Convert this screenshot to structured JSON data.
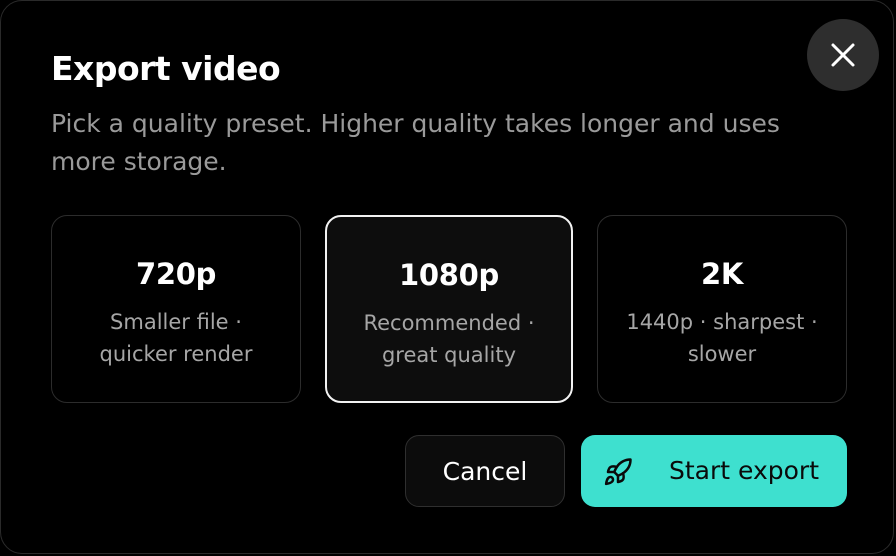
{
  "dialog": {
    "title": "Export video",
    "description": "Pick a quality preset. Higher quality takes longer and uses more storage.",
    "close_icon": "close-icon"
  },
  "presets": [
    {
      "name": "720p",
      "description": "Smaller file · quicker render",
      "selected": false
    },
    {
      "name": "1080p",
      "description": "Recommended · great quality",
      "selected": true
    },
    {
      "name": "2K",
      "description": "1440p · sharpest · slower",
      "selected": false
    }
  ],
  "actions": {
    "cancel_label": "Cancel",
    "start_label": "Start export",
    "start_icon": "rocket-icon"
  },
  "colors": {
    "accent": "#3ee0cf",
    "background": "#000000",
    "muted_text": "#9a9a9a"
  }
}
